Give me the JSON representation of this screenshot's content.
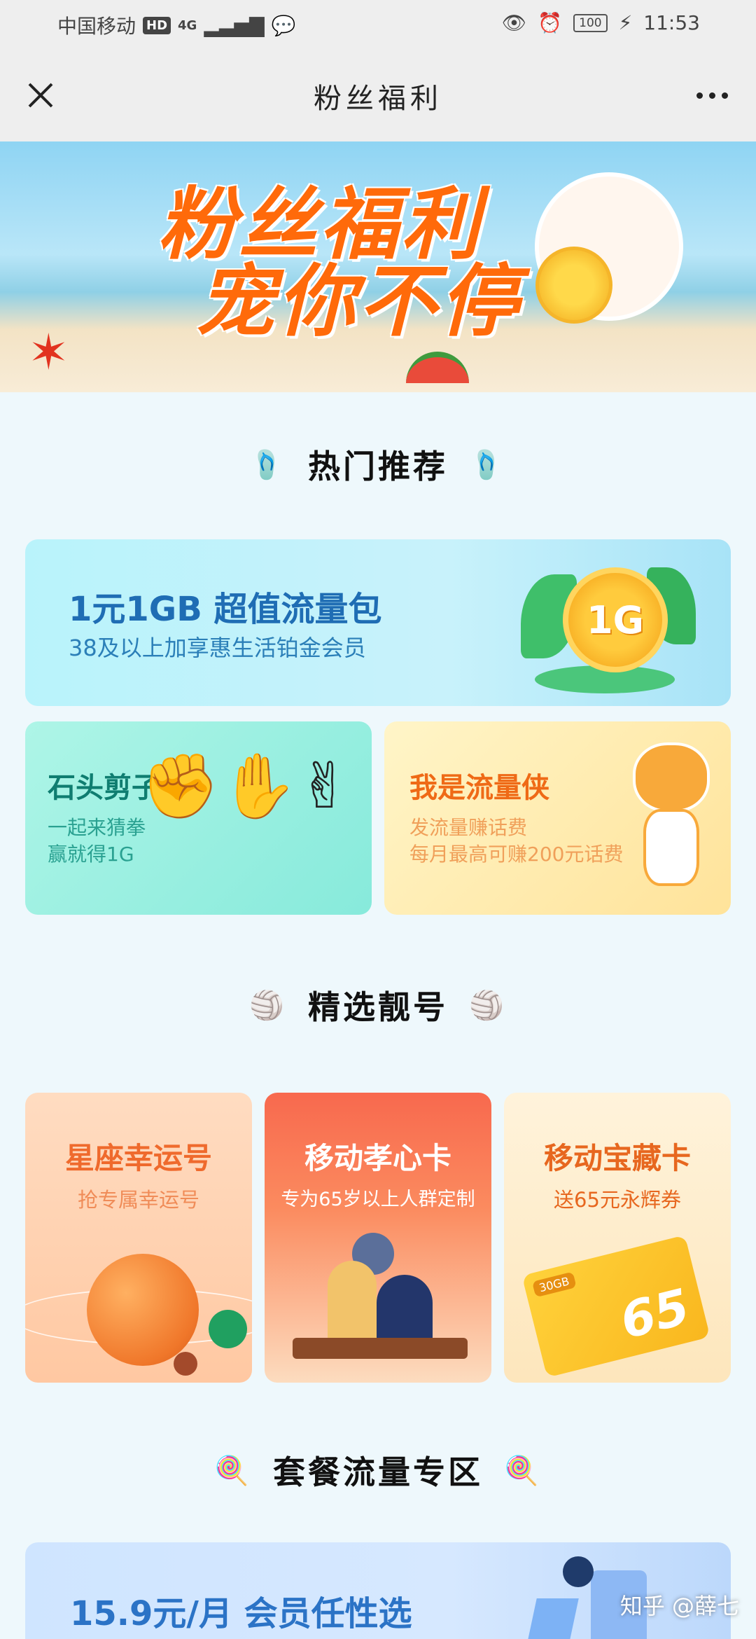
{
  "status_bar": {
    "carrier": "中国移动",
    "hd": "HD",
    "network": "4G",
    "battery": "100",
    "time": "11:53"
  },
  "header": {
    "title": "粉丝福利"
  },
  "banner": {
    "line1": "粉丝福利",
    "line2": "宠你不停"
  },
  "sections": {
    "hot": {
      "title": "热门推荐"
    },
    "numbers": {
      "title": "精选靓号"
    },
    "packages": {
      "title": "套餐流量专区"
    }
  },
  "cards": {
    "flow": {
      "title": "1元1GB 超值流量包",
      "subtitle": "38及以上加享惠生活铂金会员",
      "coin_label": "1G"
    },
    "rps": {
      "title": "石头剪子布",
      "sub1": "一起来猜拳",
      "sub2": "赢就得1G"
    },
    "hero": {
      "title": "我是流量侠",
      "sub1": "发流量赚话费",
      "sub2": "每月最高可赚200元话费"
    }
  },
  "number_cards": [
    {
      "title": "星座幸运号",
      "subtitle": "抢专属幸运号"
    },
    {
      "title": "移动孝心卡",
      "subtitle": "专为65岁以上人群定制"
    },
    {
      "title": "移动宝藏卡",
      "subtitle": "送65元永辉券",
      "card_value": "65",
      "card_label": "30GB"
    }
  ],
  "package_card": {
    "title": "15.9元/月 会员任性选"
  },
  "watermark": "知乎 @薛七",
  "colors": {
    "accent_orange": "#ff6a0a",
    "flow_blue": "#1f6db4",
    "rps_green": "#0f7d70",
    "hero_orange": "#ef6a16",
    "page_bg": "#eef8fc"
  }
}
